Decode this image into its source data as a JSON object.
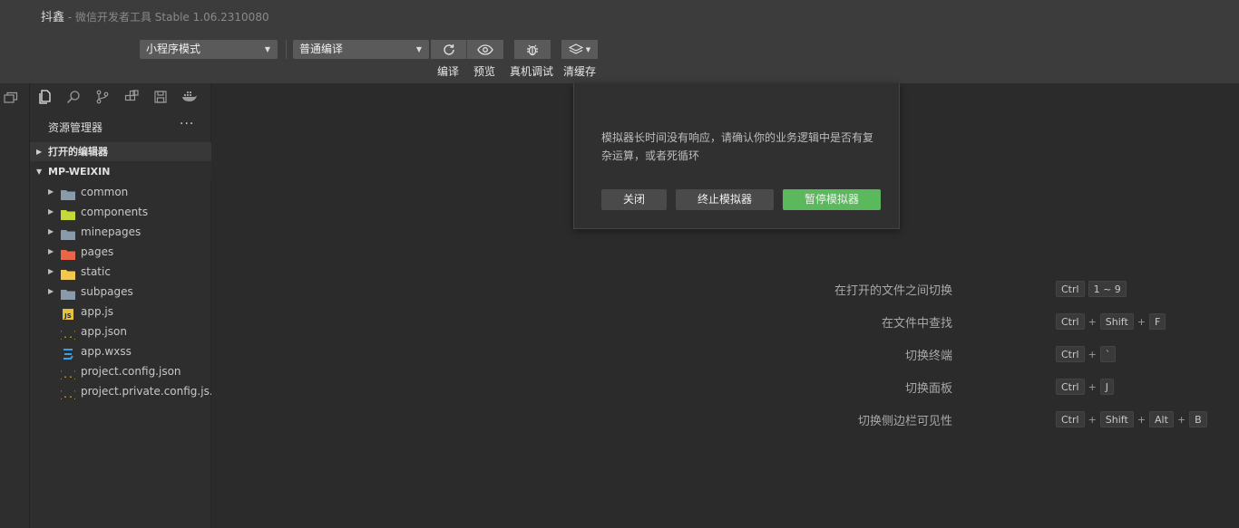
{
  "window": {
    "app_name": "抖鑫",
    "app_subtitle": " - 微信开发者工具 Stable 1.06.2310080"
  },
  "toolbar": {
    "mode_select": "小程序模式",
    "compile_select": "普通编译",
    "buttons": [
      {
        "label": "编译",
        "icon": "refresh-icon"
      },
      {
        "label": "预览",
        "icon": "eye-icon"
      },
      {
        "label": "真机调试",
        "icon": "bug-icon"
      },
      {
        "label": "清缓存",
        "icon": "layers-icon"
      }
    ]
  },
  "sidebar": {
    "panel_title": "资源管理器",
    "more": "···",
    "open_editors": "打开的编辑器",
    "project": "MP-WEIXIN",
    "items": [
      {
        "name": "common",
        "icon": "folder-icon",
        "color": "#8a9aa8",
        "folder": true
      },
      {
        "name": "components",
        "icon": "components-folder-icon",
        "color": "#c5d93a",
        "folder": true
      },
      {
        "name": "minepages",
        "icon": "folder-icon",
        "color": "#8a9aa8",
        "folder": true
      },
      {
        "name": "pages",
        "icon": "pages-folder-icon",
        "color": "#e8664a",
        "folder": true
      },
      {
        "name": "static",
        "icon": "static-folder-icon",
        "color": "#f2c94c",
        "folder": true
      },
      {
        "name": "subpages",
        "icon": "folder-icon",
        "color": "#8a9aa8",
        "folder": true
      },
      {
        "name": "app.js",
        "icon": "js-file-icon",
        "color": "#e8c33a",
        "folder": false
      },
      {
        "name": "app.json",
        "icon": "json-file-icon",
        "color": "#e8c33a",
        "folder": false
      },
      {
        "name": "app.wxss",
        "icon": "css-file-icon",
        "color": "#3aa0e8",
        "folder": false
      },
      {
        "name": "project.config.json",
        "icon": "json-file-icon",
        "color": "#e8c33a",
        "folder": false
      },
      {
        "name": "project.private.config.js...",
        "icon": "json-file-icon",
        "color": "#e8c33a",
        "folder": false
      }
    ]
  },
  "dialog": {
    "message": "模拟器长时间没有响应，请确认你的业务逻辑中是否有复杂运算，或者死循环",
    "close": "关闭",
    "terminate": "终止模拟器",
    "pause": "暂停模拟器",
    "pause_color": "#5cb85c"
  },
  "shortcuts": [
    {
      "label": "在打开的文件之间切换",
      "keys": [
        "Ctrl",
        "1 ~ 9"
      ],
      "plus": [
        false
      ]
    },
    {
      "label": "在文件中查找",
      "keys": [
        "Ctrl",
        "Shift",
        "F"
      ],
      "plus": [
        true,
        true
      ]
    },
    {
      "label": "切换终端",
      "keys": [
        "Ctrl",
        "`"
      ],
      "plus": [
        true
      ]
    },
    {
      "label": "切换面板",
      "keys": [
        "Ctrl",
        "J"
      ],
      "plus": [
        true
      ]
    },
    {
      "label": "切换侧边栏可见性",
      "keys": [
        "Ctrl",
        "Shift",
        "Alt",
        "B"
      ],
      "plus": [
        true,
        true,
        true
      ]
    }
  ]
}
